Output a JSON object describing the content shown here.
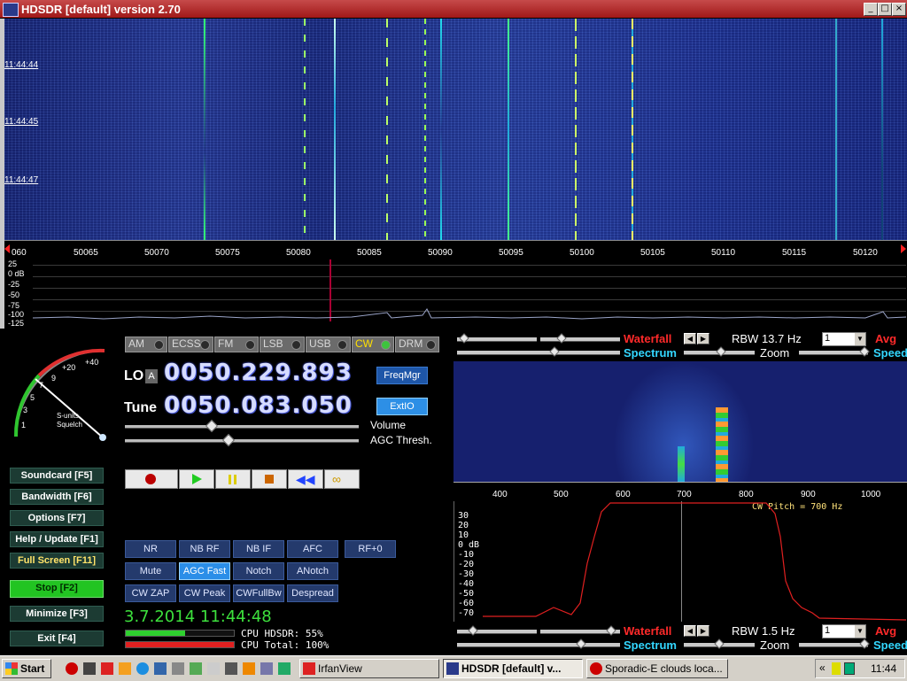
{
  "window": {
    "title": "HDSDR [default]  version 2.70"
  },
  "waterfall": {
    "timestamps": [
      "11:44:44",
      "11:44:45",
      "11:44:47"
    ]
  },
  "freq_axis": {
    "labels": [
      "060",
      "50065",
      "50070",
      "50075",
      "50080",
      "50085",
      "50090",
      "50095",
      "50100",
      "50105",
      "50110",
      "50115",
      "50120"
    ]
  },
  "spectrum": {
    "db_labels": [
      "25",
      "0 dB",
      "-25",
      "-50",
      "-75",
      "-100",
      "-125"
    ]
  },
  "modes": [
    {
      "label": "AM",
      "active": false
    },
    {
      "label": "ECSS",
      "active": false
    },
    {
      "label": "FM",
      "active": false
    },
    {
      "label": "LSB",
      "active": false
    },
    {
      "label": "USB",
      "active": false
    },
    {
      "label": "CW",
      "active": true
    },
    {
      "label": "DRM",
      "active": false
    }
  ],
  "smeter": {
    "scale": [
      "1",
      "3",
      "5",
      "7",
      "9",
      "+20",
      "+40"
    ],
    "label_a": "S-units",
    "label_b": "Squelch"
  },
  "lo": {
    "label": "LO",
    "badge": "A",
    "value": "0050.229.893"
  },
  "tune": {
    "label": "Tune",
    "value": "0050.083.050"
  },
  "buttons": {
    "freqmgr": "FreqMgr",
    "extio": "ExtIO"
  },
  "sliders": {
    "volume": "Volume",
    "agc": "AGC Thresh."
  },
  "fkeys": [
    {
      "label": "Soundcard  [F5]"
    },
    {
      "label": "Bandwidth  [F6]"
    },
    {
      "label": "Options    [F7]"
    },
    {
      "label": "Help / Update  [F1]"
    },
    {
      "label": "Full Screen  [F11]"
    },
    {
      "label": "Stop       [F2]"
    },
    {
      "label": "Minimize  [F3]"
    },
    {
      "label": "Exit       [F4]"
    }
  ],
  "dsp": {
    "row1": [
      "NR",
      "NB RF",
      "NB IF",
      "AFC",
      "RF+0"
    ],
    "row2": [
      "Mute",
      "AGC Fast",
      "Notch",
      "ANotch"
    ],
    "row3": [
      "CW ZAP",
      "CW Peak",
      "CWFullBw",
      "Despread"
    ]
  },
  "status": {
    "datetime": "3.7.2014 11:44:48",
    "cpu_hdsdr": "CPU HDSDR:  55%",
    "cpu_total": "CPU Total: 100%",
    "cpu_hdsdr_pct": 55,
    "cpu_total_pct": 100
  },
  "top_ctrl": {
    "waterfall": "Waterfall",
    "spectrum": "Spectrum",
    "rbw": "RBW 13.7 Hz",
    "avg_value": "1",
    "avg": "Avg",
    "zoom": "Zoom",
    "speed": "Speed"
  },
  "bottom_ctrl": {
    "waterfall": "Waterfall",
    "spectrum": "Spectrum",
    "rbw": "RBW   1.5 Hz",
    "avg_value": "1",
    "avg": "Avg",
    "zoom": "Zoom",
    "speed": "Speed"
  },
  "audio_axis": {
    "labels": [
      "400",
      "500",
      "600",
      "700",
      "800",
      "900",
      "1000"
    ]
  },
  "audio_spec": {
    "db_labels": [
      "30",
      "20",
      "10",
      "0 dB",
      "-10",
      "-20",
      "-30",
      "-40",
      "-50",
      "-60",
      "-70"
    ],
    "cw_pitch": "CW Pitch = 700 Hz"
  },
  "taskbar": {
    "start": "Start",
    "tasks": [
      {
        "label": "IrfanView",
        "active": false
      },
      {
        "label": "HDSDR [default]  v...",
        "active": true
      },
      {
        "label": "Sporadic-E clouds loca...",
        "active": false
      }
    ],
    "clock": "11:44"
  },
  "colors": {
    "title_bar": "#a01818",
    "waterfall_bg": "#2a3f9c",
    "accent_green": "#3de03d",
    "label_red": "#ff2a2a",
    "label_cyan": "#33d7ff"
  }
}
